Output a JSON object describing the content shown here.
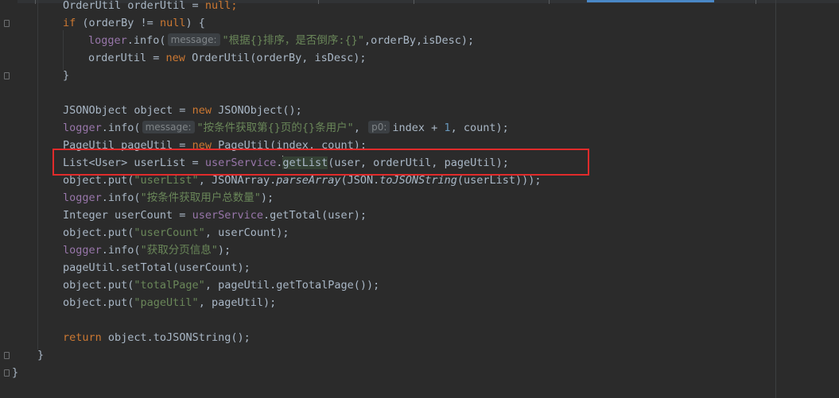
{
  "editor": {
    "language": "java",
    "colors": {
      "background": "#2b2b2b",
      "keyword": "#cc7832",
      "string": "#6a8759",
      "field": "#9876aa",
      "number": "#6897bb",
      "text": "#a9b7c6",
      "highlight_box": "#e12b2b"
    },
    "hints": {
      "message": "message:",
      "p0": "p0:"
    },
    "lines": {
      "l0": {
        "a": "OrderUtil orderUtil = ",
        "b": "null",
        "c": ";"
      },
      "l1": {
        "a": "if",
        "b": " (orderBy != ",
        "c": "null",
        "d": ") {"
      },
      "l2": {
        "a": "logger",
        "b": ".info(",
        "s": "\"根据{}排序，是否倒序:{}\"",
        "c": ",orderBy,isDesc);"
      },
      "l3": {
        "a": "orderUtil = ",
        "b": "new",
        "c": " OrderUtil(orderBy, isDesc);"
      },
      "l4": {
        "a": "}"
      },
      "l6": {
        "a": "JSONObject object = ",
        "b": "new",
        "c": " JSONObject();"
      },
      "l7": {
        "a": "logger",
        "b": ".info(",
        "s": "\"按条件获取第{}页的{}条用户\"",
        "c": ", ",
        "d": "index + ",
        "n": "1",
        "e": ", count);"
      },
      "l8": {
        "a": "PageUtil pageUtil = ",
        "b": "new",
        "c": " PageUtil(index, count);"
      },
      "l9": {
        "a": "List<User> userList = ",
        "f": "userService",
        "b": ".",
        "g": "getList",
        "c": "(user, orderUtil, pageUtil);"
      },
      "l10": {
        "a": "object.put(",
        "s": "\"userList\"",
        "b": ", JSONArray.",
        "i": "parseArray",
        "c": "(JSON.",
        "j": "toJSONString",
        "d": "(userList)));"
      },
      "l11": {
        "a": "logger",
        "b": ".info(",
        "s": "\"按条件获取用户总数量\"",
        "c": ");"
      },
      "l12": {
        "a": "Integer userCount = ",
        "f": "userService",
        "c": ".getTotal(user);"
      },
      "l13": {
        "a": "object.put(",
        "s": "\"userCount\"",
        "c": ", userCount);"
      },
      "l14": {
        "a": "logger",
        "b": ".info(",
        "s": "\"获取分页信息\"",
        "c": ");"
      },
      "l15": {
        "a": "pageUtil.setTotal(userCount);"
      },
      "l16": {
        "a": "object.put(",
        "s": "\"totalPage\"",
        "c": ", pageUtil.getTotalPage());"
      },
      "l17": {
        "a": "object.put(",
        "s": "\"pageUtil\"",
        "c": ", pageUtil);"
      },
      "l19": {
        "a": "return",
        "c": " object.toJSONString();"
      },
      "l20": {
        "a": "}"
      },
      "l21": {
        "a": "}"
      }
    }
  }
}
